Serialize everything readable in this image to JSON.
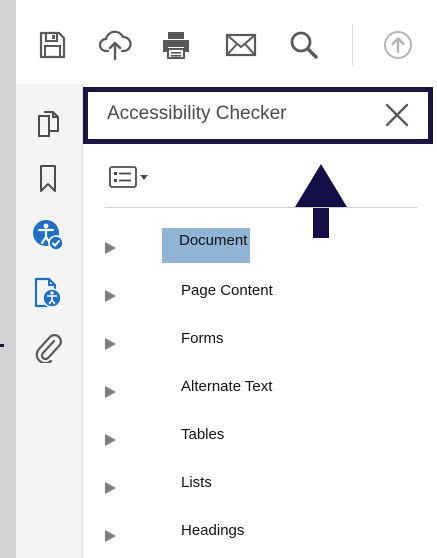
{
  "panel": {
    "title": "Accessibility Checker",
    "header_border_color": "#1a1646",
    "items": [
      {
        "label": "Document",
        "selected": true
      },
      {
        "label": "Page Content",
        "selected": false
      },
      {
        "label": "Forms",
        "selected": false
      },
      {
        "label": "Alternate Text",
        "selected": false
      },
      {
        "label": "Tables",
        "selected": false
      },
      {
        "label": "Lists",
        "selected": false
      },
      {
        "label": "Headings",
        "selected": false
      }
    ]
  },
  "toolbar": {
    "icons": [
      "save-icon",
      "cloud-upload-icon",
      "print-icon",
      "email-icon",
      "search-icon",
      "share-icon"
    ]
  },
  "leftrail": {
    "icons": [
      "pages-icon",
      "bookmark-icon",
      "accessibility-checker-icon",
      "accessibility-tags-icon",
      "attachment-icon"
    ],
    "accent_color": "#1f6fc4"
  },
  "annotation": {
    "arrow_color": "#141047"
  }
}
